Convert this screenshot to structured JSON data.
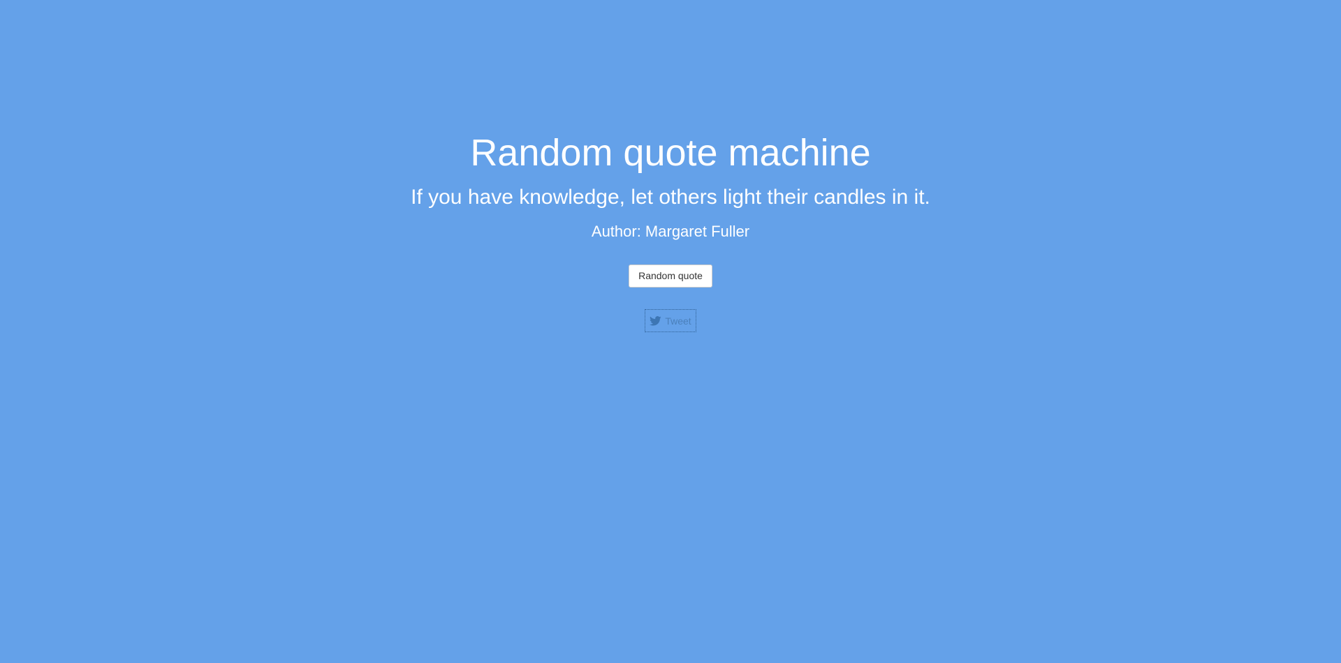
{
  "page": {
    "title": "Random quote machine"
  },
  "quote": {
    "text": "If you have knowledge, let others light their candles in it.",
    "author": "Author: Margaret Fuller"
  },
  "actions": {
    "random_label": "Random quote",
    "tweet_label": "Tweet",
    "tweet_icon": "twitter-icon"
  },
  "colors": {
    "background": "#64a1e9",
    "text": "#ffffff",
    "tweet_text": "#4a80bb"
  }
}
